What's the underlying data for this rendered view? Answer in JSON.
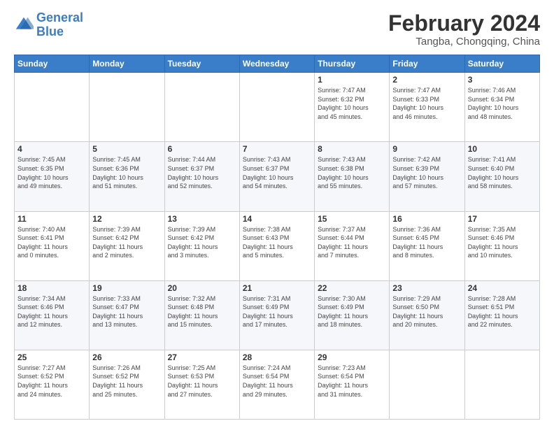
{
  "logo": {
    "text_general": "General",
    "text_blue": "Blue"
  },
  "header": {
    "month": "February 2024",
    "location": "Tangba, Chongqing, China"
  },
  "weekdays": [
    "Sunday",
    "Monday",
    "Tuesday",
    "Wednesday",
    "Thursday",
    "Friday",
    "Saturday"
  ],
  "weeks": [
    [
      {
        "day": "",
        "info": ""
      },
      {
        "day": "",
        "info": ""
      },
      {
        "day": "",
        "info": ""
      },
      {
        "day": "",
        "info": ""
      },
      {
        "day": "1",
        "info": "Sunrise: 7:47 AM\nSunset: 6:32 PM\nDaylight: 10 hours\nand 45 minutes."
      },
      {
        "day": "2",
        "info": "Sunrise: 7:47 AM\nSunset: 6:33 PM\nDaylight: 10 hours\nand 46 minutes."
      },
      {
        "day": "3",
        "info": "Sunrise: 7:46 AM\nSunset: 6:34 PM\nDaylight: 10 hours\nand 48 minutes."
      }
    ],
    [
      {
        "day": "4",
        "info": "Sunrise: 7:45 AM\nSunset: 6:35 PM\nDaylight: 10 hours\nand 49 minutes."
      },
      {
        "day": "5",
        "info": "Sunrise: 7:45 AM\nSunset: 6:36 PM\nDaylight: 10 hours\nand 51 minutes."
      },
      {
        "day": "6",
        "info": "Sunrise: 7:44 AM\nSunset: 6:37 PM\nDaylight: 10 hours\nand 52 minutes."
      },
      {
        "day": "7",
        "info": "Sunrise: 7:43 AM\nSunset: 6:37 PM\nDaylight: 10 hours\nand 54 minutes."
      },
      {
        "day": "8",
        "info": "Sunrise: 7:43 AM\nSunset: 6:38 PM\nDaylight: 10 hours\nand 55 minutes."
      },
      {
        "day": "9",
        "info": "Sunrise: 7:42 AM\nSunset: 6:39 PM\nDaylight: 10 hours\nand 57 minutes."
      },
      {
        "day": "10",
        "info": "Sunrise: 7:41 AM\nSunset: 6:40 PM\nDaylight: 10 hours\nand 58 minutes."
      }
    ],
    [
      {
        "day": "11",
        "info": "Sunrise: 7:40 AM\nSunset: 6:41 PM\nDaylight: 11 hours\nand 0 minutes."
      },
      {
        "day": "12",
        "info": "Sunrise: 7:39 AM\nSunset: 6:42 PM\nDaylight: 11 hours\nand 2 minutes."
      },
      {
        "day": "13",
        "info": "Sunrise: 7:39 AM\nSunset: 6:42 PM\nDaylight: 11 hours\nand 3 minutes."
      },
      {
        "day": "14",
        "info": "Sunrise: 7:38 AM\nSunset: 6:43 PM\nDaylight: 11 hours\nand 5 minutes."
      },
      {
        "day": "15",
        "info": "Sunrise: 7:37 AM\nSunset: 6:44 PM\nDaylight: 11 hours\nand 7 minutes."
      },
      {
        "day": "16",
        "info": "Sunrise: 7:36 AM\nSunset: 6:45 PM\nDaylight: 11 hours\nand 8 minutes."
      },
      {
        "day": "17",
        "info": "Sunrise: 7:35 AM\nSunset: 6:46 PM\nDaylight: 11 hours\nand 10 minutes."
      }
    ],
    [
      {
        "day": "18",
        "info": "Sunrise: 7:34 AM\nSunset: 6:46 PM\nDaylight: 11 hours\nand 12 minutes."
      },
      {
        "day": "19",
        "info": "Sunrise: 7:33 AM\nSunset: 6:47 PM\nDaylight: 11 hours\nand 13 minutes."
      },
      {
        "day": "20",
        "info": "Sunrise: 7:32 AM\nSunset: 6:48 PM\nDaylight: 11 hours\nand 15 minutes."
      },
      {
        "day": "21",
        "info": "Sunrise: 7:31 AM\nSunset: 6:49 PM\nDaylight: 11 hours\nand 17 minutes."
      },
      {
        "day": "22",
        "info": "Sunrise: 7:30 AM\nSunset: 6:49 PM\nDaylight: 11 hours\nand 18 minutes."
      },
      {
        "day": "23",
        "info": "Sunrise: 7:29 AM\nSunset: 6:50 PM\nDaylight: 11 hours\nand 20 minutes."
      },
      {
        "day": "24",
        "info": "Sunrise: 7:28 AM\nSunset: 6:51 PM\nDaylight: 11 hours\nand 22 minutes."
      }
    ],
    [
      {
        "day": "25",
        "info": "Sunrise: 7:27 AM\nSunset: 6:52 PM\nDaylight: 11 hours\nand 24 minutes."
      },
      {
        "day": "26",
        "info": "Sunrise: 7:26 AM\nSunset: 6:52 PM\nDaylight: 11 hours\nand 25 minutes."
      },
      {
        "day": "27",
        "info": "Sunrise: 7:25 AM\nSunset: 6:53 PM\nDaylight: 11 hours\nand 27 minutes."
      },
      {
        "day": "28",
        "info": "Sunrise: 7:24 AM\nSunset: 6:54 PM\nDaylight: 11 hours\nand 29 minutes."
      },
      {
        "day": "29",
        "info": "Sunrise: 7:23 AM\nSunset: 6:54 PM\nDaylight: 11 hours\nand 31 minutes."
      },
      {
        "day": "",
        "info": ""
      },
      {
        "day": "",
        "info": ""
      }
    ]
  ]
}
